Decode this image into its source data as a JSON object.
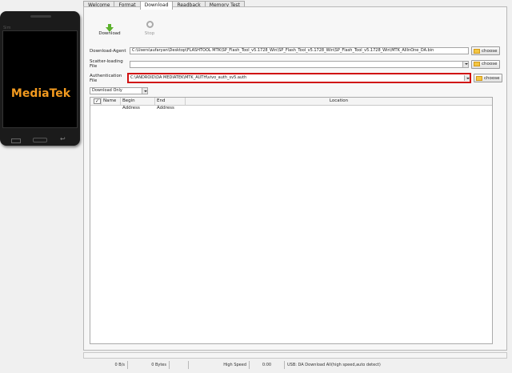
{
  "tabs": [
    "Welcome",
    "Format",
    "Download",
    "Readback",
    "Memory Test"
  ],
  "phone": {
    "logo": "MediaTek",
    "brand_small": "Sim"
  },
  "toolbar": {
    "download_label": "Download",
    "stop_label": "Stop"
  },
  "download_agent": {
    "label": "Download-Agent",
    "value": "C:\\Users\\aufaryan\\Desktop\\FLASHTOOL MTK\\SP_Flash_Tool_v5.1728_Win\\SP_Flash_Tool_v5.1728_Win\\SP_Flash_Tool_v5.1728_Win\\MTK_AllInOne_DA.bin"
  },
  "scatter": {
    "label": "Scatter-loading File",
    "value": ""
  },
  "auth": {
    "label": "Authentication File",
    "value": "C:\\ANDROID\\DA MEDIATEK\\MTK_AUTH\\vivo_auth_sv5.auth"
  },
  "choose_label": "choose",
  "mode": {
    "value": "Download Only"
  },
  "table": {
    "headers": [
      "Name",
      "Begin Address",
      "End Address",
      "Location"
    ]
  },
  "status": {
    "speed": "0 B/s",
    "bytes": "0 Bytes",
    "blank1": "",
    "mode": "High Speed",
    "time": "0:00",
    "msg": "USB: DA Download All(high speed,auto detect)"
  }
}
